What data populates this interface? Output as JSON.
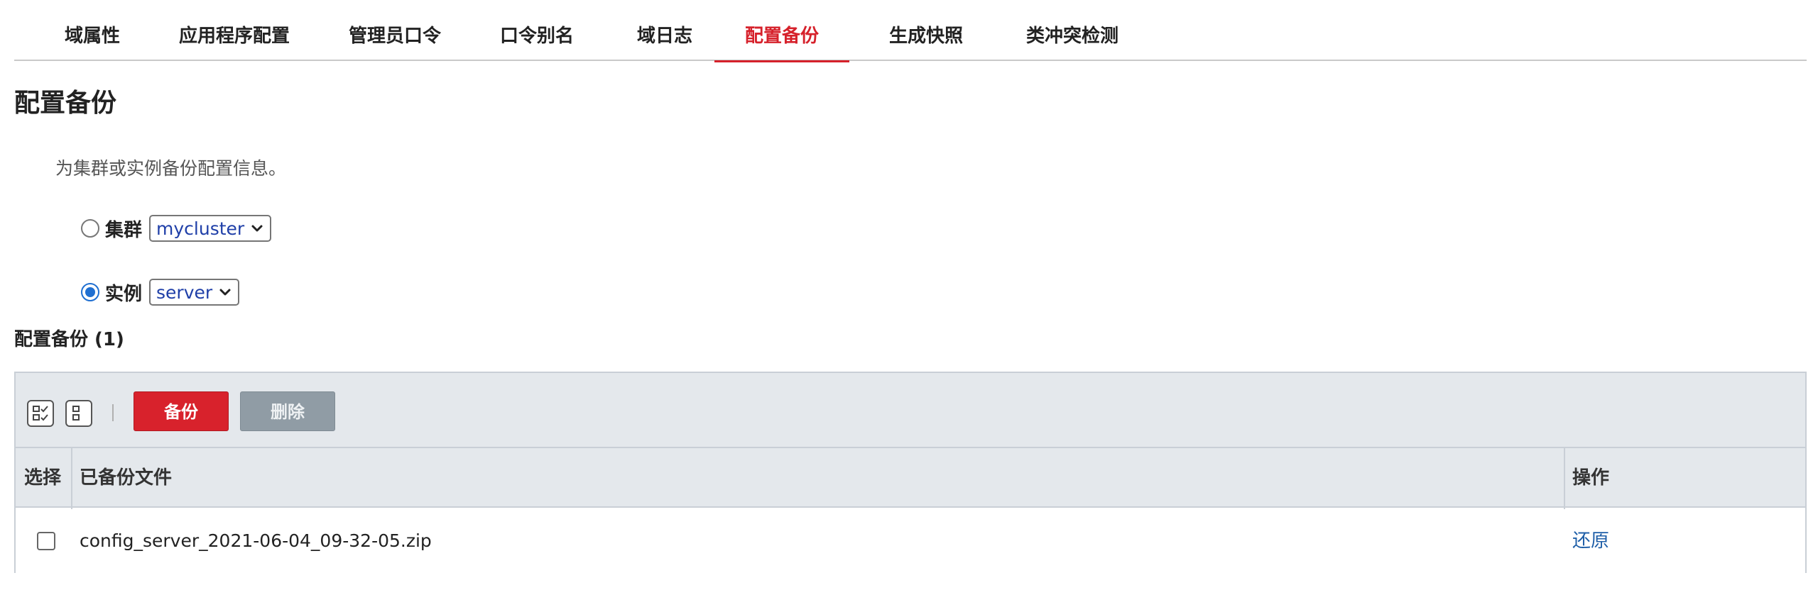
{
  "tabs": [
    {
      "label": "域属性",
      "active": false
    },
    {
      "label": "应用程序配置",
      "active": false
    },
    {
      "label": "管理员口令",
      "active": false
    },
    {
      "label": "口令别名",
      "active": false
    },
    {
      "label": "域日志",
      "active": false
    },
    {
      "label": "配置备份",
      "active": true
    },
    {
      "label": "生成快照",
      "active": false
    },
    {
      "label": "类冲突检测",
      "active": false
    }
  ],
  "page": {
    "title": "配置备份",
    "description": "为集群或实例备份配置信息。"
  },
  "target": {
    "cluster": {
      "label": "集群",
      "selected": "mycluster",
      "checked": false
    },
    "instance": {
      "label": "实例",
      "selected": "server",
      "checked": true
    }
  },
  "backups": {
    "section_title": "配置备份 (1)",
    "toolbar": {
      "select_all_icon": "select-all-icon",
      "deselect_all_icon": "deselect-all-icon",
      "backup_label": "备份",
      "delete_label": "删除",
      "delete_enabled": false
    },
    "columns": [
      "选择",
      "已备份文件",
      "操作"
    ],
    "rows": [
      {
        "file": "config_server_2021-06-04_09-32-05.zip",
        "action": "还原",
        "selected": false
      }
    ]
  },
  "colors": {
    "accent": "#d6212b",
    "link": "#1f5fa8",
    "radio_checked": "#1f6fd1",
    "toolbar_bg": "#e4e8ec",
    "disabled_button": "#909ca5"
  }
}
